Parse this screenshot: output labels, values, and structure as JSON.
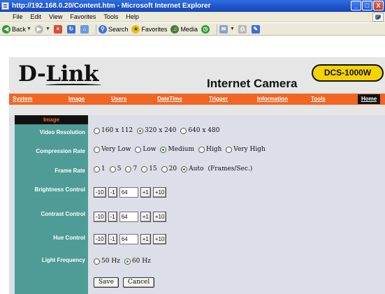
{
  "window": {
    "title": "http://192.168.0.20/Content.htm - Microsoft Internet Explorer",
    "buttons": [
      "_",
      "□",
      "X"
    ]
  },
  "menubar": {
    "items": [
      "File",
      "Edit",
      "View",
      "Favorites",
      "Tools",
      "Help"
    ]
  },
  "toolbar": {
    "back": "Back",
    "search": "Search",
    "favorites": "Favorites",
    "media": "Media"
  },
  "header": {
    "logo": "D-Link",
    "product": "Internet Camera",
    "model": "DCS-1000W"
  },
  "nav": {
    "items": [
      "System",
      "Image",
      "Users",
      "DateTime",
      "Trigger",
      "Information",
      "Tools",
      "Home"
    ],
    "active": "Home"
  },
  "section": {
    "title": "Image"
  },
  "form": {
    "video_resolution": {
      "label": "Video Resolution",
      "options": [
        "160 x 112",
        "320 x 240",
        "640 x 480"
      ],
      "selected": "320 x 240"
    },
    "compression_rate": {
      "label": "Compression Rate",
      "options": [
        "Very Low",
        "Low",
        "Medium",
        "High",
        "Very High"
      ],
      "selected": "Medium"
    },
    "frame_rate": {
      "label": "Frame Rate",
      "options": [
        "1",
        "5",
        "7",
        "15",
        "20",
        "Auto"
      ],
      "selected": "Auto",
      "unit": "(Frames/Sec.)"
    },
    "brightness": {
      "label": "Brightness Control",
      "buttons": [
        "-10",
        "-1",
        "+1",
        "+10"
      ],
      "value": "64"
    },
    "contrast": {
      "label": "Contrast Control",
      "buttons": [
        "-10",
        "-1",
        "+1",
        "+10"
      ],
      "value": "64"
    },
    "hue": {
      "label": "Hue Control",
      "buttons": [
        "-10",
        "-1",
        "+1",
        "+10"
      ],
      "value": "64"
    },
    "light_frequency": {
      "label": "Light Frequency",
      "options": [
        "50 Hz",
        "60 Hz"
      ],
      "selected": "60 Hz"
    },
    "save_label": "Save",
    "cancel_label": "Cancel"
  },
  "colors": {
    "nav_orange": "#f26522",
    "label_teal": "#4f9c96",
    "form_bg": "#dcdee8",
    "badge_yellow": "#f6d200"
  }
}
